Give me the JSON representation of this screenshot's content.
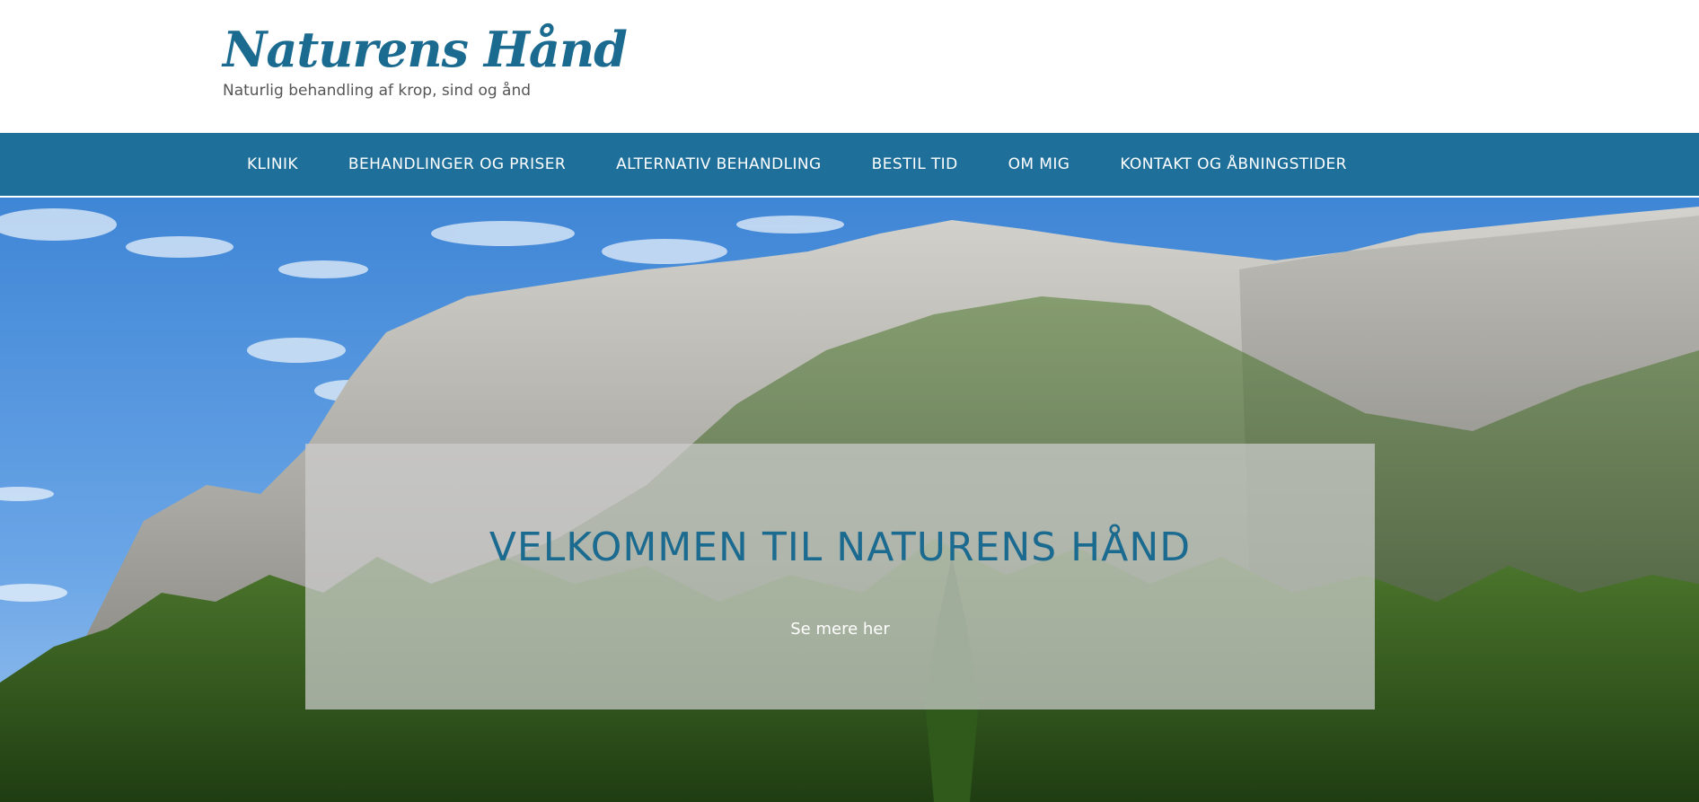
{
  "site": {
    "title": "Naturens Hånd",
    "tagline": "Naturlig behandling af krop, sind og ånd"
  },
  "nav": {
    "items": [
      {
        "label": "KLINIK"
      },
      {
        "label": "BEHANDLINGER OG PRISER"
      },
      {
        "label": "ALTERNATIV BEHANDLING"
      },
      {
        "label": "BESTIL TID"
      },
      {
        "label": "OM MIG"
      },
      {
        "label": "KONTAKT OG ÅBNINGSTIDER"
      }
    ]
  },
  "hero": {
    "heading": "VELKOMMEN TIL NATURENS HÅND",
    "link_label": "Se mere her"
  },
  "colors": {
    "brand": "#1b6a8f",
    "nav_background": "#1f6f9b",
    "nav_text": "#ffffff",
    "overlay": "#cdcdcd"
  }
}
